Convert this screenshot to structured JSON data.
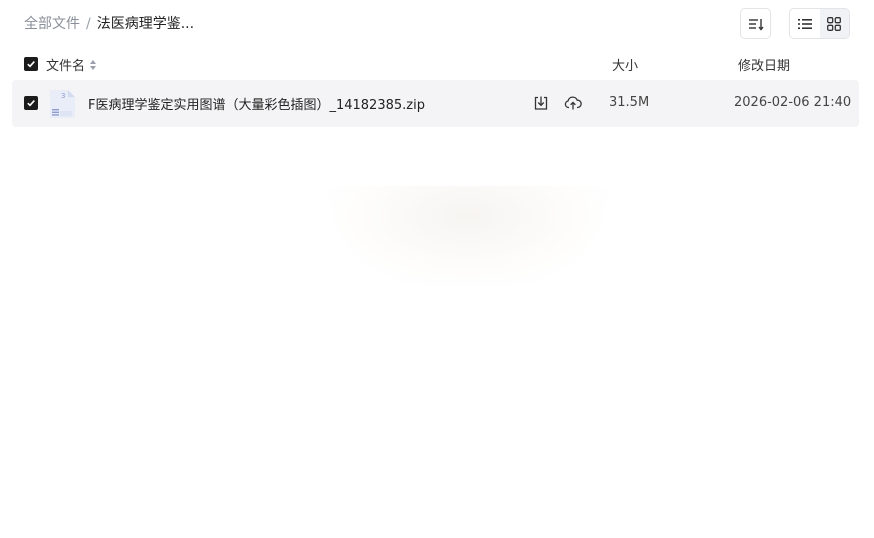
{
  "breadcrumb": {
    "root": "全部文件",
    "separator": "/",
    "current": "法医病理学鉴..."
  },
  "toolbar": {
    "sort_icon": "sort-lines-icon",
    "view_list_icon": "list-view-icon",
    "view_grid_icon": "grid-view-icon",
    "active_view": "list"
  },
  "columns": {
    "name": "文件名",
    "size": "大小",
    "date": "修改日期"
  },
  "files": [
    {
      "checked": true,
      "icon": "zip-archive-icon",
      "name": "F医病理学鉴定实用图谱（大量彩色插图）_14182385.zip",
      "size": "31.5M",
      "modified": "2026-02-06 21:40"
    }
  ],
  "colors": {
    "row_bg": "#f4f4f6",
    "checkbox": "#1b1b1b",
    "muted_text": "#8a8f99"
  }
}
